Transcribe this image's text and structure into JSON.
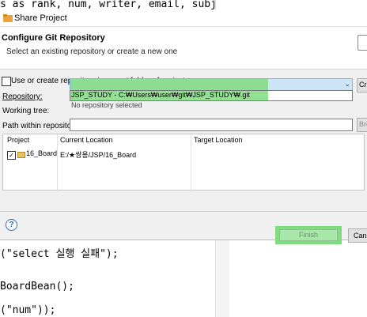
{
  "editor": {
    "line_top": "s as rank, num, writer, email, subject, p",
    "line_select": "(\"select 실행 실패\");",
    "line_bean": "BoardBean();",
    "line_num": "(\"num\"));"
  },
  "dialog": {
    "title": "Share Project",
    "banner_title": "Configure Git Repository",
    "banner_desc": "Select an existing repository or create a new one",
    "use_parent_label": "Use or create repository in parent folder of project",
    "repository_label": "Repository:",
    "repository_option": "JSP_STUDY - C:₩Users₩user₩git₩JSP_STUDY₩.git",
    "create_button": "Cr",
    "working_tree_label": "Working tree:",
    "working_tree_value": "No repository selected",
    "path_label": "Path within repository:",
    "browse_button": "Brc",
    "table": {
      "headers": [
        "Project",
        "Current Location",
        "Target Location"
      ],
      "rows": [
        {
          "project": "16_Board",
          "current": "E:/★쌍용/JSP/16_Board",
          "target": ""
        }
      ]
    },
    "finish_button": "Finish",
    "cancel_button": "Canc"
  },
  "colors": {
    "title_icon": "#e8a33c",
    "highlight": "#7fdc7f",
    "selection": "#cce4f7"
  }
}
